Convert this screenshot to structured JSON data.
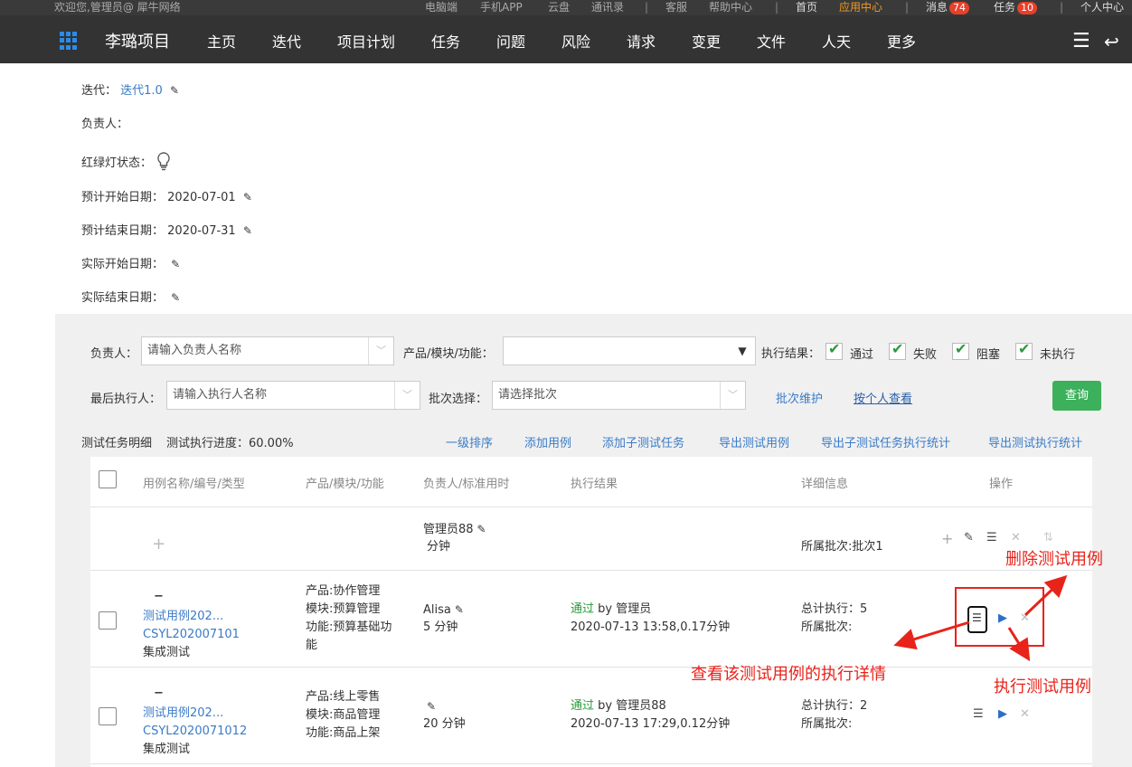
{
  "topbar": {
    "welcome": "欢迎您,管理员@ 犀牛网络",
    "links": [
      "电脑端",
      "手机APP",
      "云盘",
      "通讯录",
      "客服",
      "帮助中心"
    ],
    "home": "首页",
    "app_center": "应用中心",
    "messages_label": "消息",
    "messages_count": "74",
    "tasks_label": "任务",
    "tasks_count": "10",
    "personal": "个人中心"
  },
  "nav": {
    "project": "李璐项目",
    "items": [
      "主页",
      "迭代",
      "项目计划",
      "任务",
      "问题",
      "风险",
      "请求",
      "变更",
      "文件",
      "人天",
      "更多"
    ]
  },
  "info": {
    "iteration_label": "迭代：",
    "iteration_value": "迭代1.0",
    "owner_label": "负责人：",
    "light_label": "红绿灯状态：",
    "plan_start_label": "预计开始日期：",
    "plan_start": "2020-07-01",
    "plan_end_label": "预计结束日期：",
    "plan_end": "2020-07-31",
    "actual_start_label": "实际开始日期：",
    "actual_end_label": "实际结束日期："
  },
  "filter": {
    "owner_label": "负责人：",
    "owner_placeholder": "请输入负责人名称",
    "product_label": "产品/模块/功能：",
    "result_label": "执行结果：",
    "results": [
      "通过",
      "失败",
      "阻塞",
      "未执行"
    ],
    "executor_label": "最后执行人：",
    "executor_placeholder": "请输入执行人名称",
    "batch_label": "批次选择：",
    "batch_placeholder": "请选择批次",
    "batch_maintain": "批次维护",
    "by_person": "按个人查看",
    "query": "查询"
  },
  "summary": {
    "title": "测试任务明细",
    "progress": "测试执行进度：60.00%",
    "actions": [
      "一级排序",
      "添加用例",
      "添加子测试任务",
      "导出测试用例",
      "导出子测试任务执行统计",
      "导出测试执行统计"
    ]
  },
  "table": {
    "headers": [
      "用例名称/编号/类型",
      "产品/模块/功能",
      "负责人/标准用时",
      "执行结果",
      "详细信息",
      "操作"
    ],
    "group_row": {
      "owner": "管理员88",
      "time": "分钟",
      "batch": "所属批次:批次1"
    },
    "rows": [
      {
        "name": "测试用例202...",
        "code": "CSYL202007101",
        "type": "集成测试",
        "product": "产品:协作管理",
        "module": "模块:预算管理",
        "function1": "功能:预算基础功",
        "function2": "能",
        "owner": "Alisa",
        "time": "5 分钟",
        "result": "通过",
        "by": " by 管理员",
        "exec_time": "2020-07-13 13:58,0.17分钟",
        "total": "总计执行：5",
        "batch": "所属批次:"
      },
      {
        "name": "测试用例202...",
        "code": "CSYL2020071012",
        "type": "集成测试",
        "product": "产品:线上零售",
        "module": "模块:商品管理",
        "function1": "功能:商品上架",
        "function2": "",
        "owner": "",
        "time": "20 分钟",
        "result": "通过",
        "by": " by 管理员88",
        "exec_time": "2020-07-13 17:29,0.12分钟",
        "total": "总计执行：2",
        "batch": "所属批次:"
      }
    ]
  },
  "annotations": {
    "delete": "删除测试用例",
    "view": "查看该测试用例的执行详情",
    "execute": "执行测试用例"
  },
  "colors": {
    "accent": "#3a7bc8",
    "annotation": "#e8231a",
    "pass": "#2a9a3a",
    "query": "#3cb05a"
  }
}
